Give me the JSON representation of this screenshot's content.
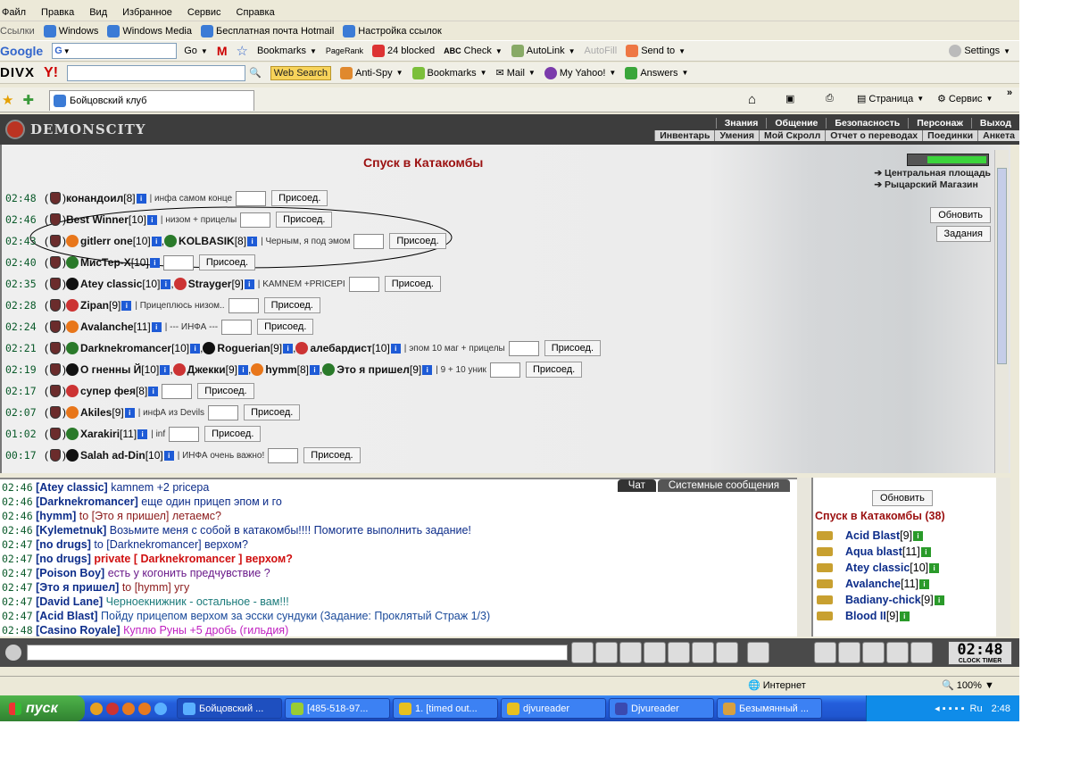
{
  "menubar": [
    "Файл",
    "Правка",
    "Вид",
    "Избранное",
    "Сервис",
    "Справка"
  ],
  "linksbar": {
    "label": "Ссылки",
    "items": [
      "Windows",
      "Windows Media",
      "Бесплатная почта Hotmail",
      "Настройка ссылок"
    ]
  },
  "googlebar": {
    "logo": "Google",
    "go": "Go",
    "items": [
      "Bookmarks",
      "PageRank",
      "24 blocked",
      "Check",
      "AutoLink",
      "AutoFill",
      "Send to"
    ],
    "settings": "Settings"
  },
  "divxbar": {
    "logo": "DIVX",
    "web_search": "Web Search",
    "items": [
      "Anti-Spy",
      "Bookmarks",
      "Mail",
      "My Yahoo!",
      "Answers"
    ]
  },
  "tabsbar": {
    "tab_title": "Бойцовский клуб",
    "page": "Страница",
    "service": "Сервис"
  },
  "game": {
    "logo": "DEMONSCITY",
    "nav1": [
      "Знания",
      "Общение",
      "Безопасность",
      "Персонаж",
      "Выход"
    ],
    "nav2": [
      "Инвентарь",
      "Умения",
      "Мой Скролл",
      "Отчет о переводах",
      "Поединки",
      "Анкета"
    ],
    "title": "Спуск в Катакомбы",
    "side_links": [
      "Центральная площадь",
      "Рыцарский Магазин"
    ],
    "refresh": "Обновить",
    "tasks": "Задания",
    "join": "Присоед.",
    "groups": [
      {
        "time": "02:48",
        "players": [
          {
            "name": "конандоил",
            "level": "[8]"
          }
        ],
        "comment": "инфа самом конце"
      },
      {
        "time": "02:46",
        "players": [
          {
            "name": "Best Winner",
            "level": "[10]"
          }
        ],
        "comment": "низом + прицелы"
      },
      {
        "time": "02:43",
        "players": [
          {
            "name": "gitlerr one",
            "level": "[10]"
          },
          {
            "name": "KOLBASIK",
            "level": "[8]"
          }
        ],
        "comment": "Черным, я под эмом"
      },
      {
        "time": "02:40",
        "players": [
          {
            "name": "МисТер-Х",
            "level": "[10]"
          }
        ],
        "comment": ""
      },
      {
        "time": "02:35",
        "players": [
          {
            "name": "Atey classic",
            "level": "[10]"
          },
          {
            "name": "Strayger",
            "level": "[9]"
          }
        ],
        "comment": "KAMNEM +PRICEPI"
      },
      {
        "time": "02:28",
        "players": [
          {
            "name": "Zipan",
            "level": "[9]"
          }
        ],
        "comment": "Прицеплюсь низом.."
      },
      {
        "time": "02:24",
        "players": [
          {
            "name": "Avalanche",
            "level": "[11]"
          }
        ],
        "comment": "--- ИНФА ---"
      },
      {
        "time": "02:21",
        "players": [
          {
            "name": "Darknekromancer",
            "level": "[10]"
          },
          {
            "name": "Roguerian",
            "level": "[9]"
          },
          {
            "name": "алебардист",
            "level": "[10]"
          }
        ],
        "comment": "эпом 10 маг + прицелы"
      },
      {
        "time": "02:19",
        "players": [
          {
            "name": "О гненны Й",
            "level": "[10]"
          },
          {
            "name": "Джекки",
            "level": "[9]"
          },
          {
            "name": "hymm",
            "level": "[8]"
          },
          {
            "name": "Это я пришел",
            "level": "[9]"
          }
        ],
        "comment": "9 + 10 уник"
      },
      {
        "time": "02:17",
        "players": [
          {
            "name": "супер фея",
            "level": "[8]"
          }
        ],
        "comment": ""
      },
      {
        "time": "02:07",
        "players": [
          {
            "name": "Akiles",
            "level": "[9]"
          }
        ],
        "comment": "инфА из Devils"
      },
      {
        "time": "01:02",
        "players": [
          {
            "name": "Xarakiri",
            "level": "[11]"
          }
        ],
        "comment": "inf"
      },
      {
        "time": "00:17",
        "players": [
          {
            "name": "Salah ad-Din",
            "level": "[10]"
          }
        ],
        "comment": "ИНФА очень важно!"
      }
    ]
  },
  "chat": {
    "tab_chat": "Чат",
    "tab_system": "Системные сообщения",
    "lines": [
      {
        "time": "02:46",
        "sender": "[Atey classic]",
        "text": "kamnem +2 pricepa",
        "color": "#0d2d8a"
      },
      {
        "time": "02:46",
        "sender": "[Darknekromancer]",
        "text": "еще один прицеп эпом и го",
        "color": "#0d2d8a"
      },
      {
        "time": "02:46",
        "sender": "[hymm]",
        "text": "to [Это я пришел] летаемс?",
        "color": "#8b1a1a"
      },
      {
        "time": "02:46",
        "sender": "[Kylemetnuk]",
        "text": "Возьмите меня с собой в катакомбы!!!! Помогите выполнить задание!",
        "color": "#0d2d8a"
      },
      {
        "time": "02:47",
        "sender": "[no drugs]",
        "text": "to [Darknekromancer] верхом?",
        "color": "#0d2d8a"
      },
      {
        "time": "02:47",
        "sender": "[no drugs]",
        "text": "private [ Darknekromancer ] верхом?",
        "color": "#d01010"
      },
      {
        "time": "02:47",
        "sender": "[Poison Boy]",
        "text": "есть у когонить предчувствие ?",
        "color": "#6a1a8a"
      },
      {
        "time": "02:47",
        "sender": "[Это я пришел]",
        "text": "to [hymm] угу",
        "color": "#8b1a1a"
      },
      {
        "time": "02:47",
        "sender": "[David Lane]",
        "text": "Черноекнижник - остальное - вам!!!",
        "color": "#1a7a7a"
      },
      {
        "time": "02:47",
        "sender": "[Acid Blast]",
        "text": "Пойду прицепом верхом за эсски сундуки (Задание: Проклятый Страж 1/3)",
        "color": "#1a4a9a"
      },
      {
        "time": "02:48",
        "sender": "[Casino Royale]",
        "text": "Куплю Руны +5 дробь (гильдия)",
        "color": "#c020c0"
      }
    ]
  },
  "online": {
    "refresh": "Обновить",
    "title": "Спуск в Катакомбы (38)",
    "players": [
      {
        "name": "Acid Blast",
        "level": "[9]"
      },
      {
        "name": "Aqua blast",
        "level": "[11]"
      },
      {
        "name": "Atey classic",
        "level": "[10]"
      },
      {
        "name": "Avalanche",
        "level": "[11]"
      },
      {
        "name": "Badiany-chick",
        "level": "[9]"
      },
      {
        "name": "Blood II",
        "level": "[9]"
      }
    ]
  },
  "clock": {
    "time": "02:48",
    "sub": "CLOCK TIMER"
  },
  "statusbar": {
    "zone": "Интернет",
    "zoom": "100%"
  },
  "taskbar": {
    "start": "пуск",
    "tasks": [
      "Бойцовский ...",
      "[485-518-97...",
      "1. [timed out...",
      "djvureader",
      "Djvureader",
      "Безымянный ..."
    ],
    "lang": "Ru",
    "time": "2:48"
  },
  "colors": {
    "accent_red": "#9b1010",
    "chat_blue": "#0d2d8a",
    "taskbar_blue": "#245edb",
    "start_green": "#3c963a"
  }
}
